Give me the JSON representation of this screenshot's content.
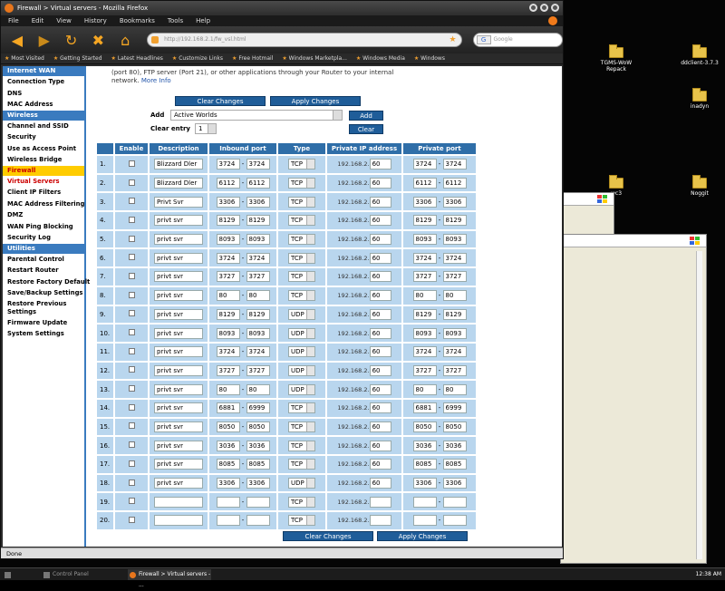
{
  "window": {
    "title": "Firewall > Virtual servers - Mozilla Firefox"
  },
  "menu": [
    "File",
    "Edit",
    "View",
    "History",
    "Bookmarks",
    "Tools",
    "Help"
  ],
  "url": "http://192.168.2.1/fw_vsl.html",
  "search_placeholder": "Google",
  "bookmarks": [
    "Most Visited",
    "Getting Started",
    "Latest Headlines",
    "Customize Links",
    "Free Hotmail",
    "Windows Marketpla...",
    "Windows Media",
    "Windows"
  ],
  "sidebar": [
    {
      "type": "head",
      "label": "Internet WAN"
    },
    {
      "type": "item",
      "label": "Connection Type"
    },
    {
      "type": "item",
      "label": "DNS"
    },
    {
      "type": "item",
      "label": "MAC Address"
    },
    {
      "type": "head",
      "label": "Wireless"
    },
    {
      "type": "item",
      "label": "Channel and SSID"
    },
    {
      "type": "item",
      "label": "Security"
    },
    {
      "type": "item",
      "label": "Use as Access Point"
    },
    {
      "type": "item",
      "label": "Wireless Bridge"
    },
    {
      "type": "head",
      "label": "Firewall",
      "active": true
    },
    {
      "type": "item",
      "label": "Virtual Servers",
      "active": true
    },
    {
      "type": "item",
      "label": "Client IP Filters"
    },
    {
      "type": "item",
      "label": "MAC Address Filtering"
    },
    {
      "type": "item",
      "label": "DMZ"
    },
    {
      "type": "item",
      "label": "WAN Ping Blocking"
    },
    {
      "type": "item",
      "label": "Security Log"
    },
    {
      "type": "head",
      "label": "Utilities"
    },
    {
      "type": "item",
      "label": "Parental Control"
    },
    {
      "type": "item",
      "label": "Restart Router"
    },
    {
      "type": "item",
      "label": "Restore Factory Default"
    },
    {
      "type": "item",
      "label": "Save/Backup Settings"
    },
    {
      "type": "item",
      "label": "Restore Previous Settings",
      "two": true
    },
    {
      "type": "item",
      "label": "Firmware Update"
    },
    {
      "type": "item",
      "label": "System Settings"
    }
  ],
  "intro": {
    "line1": "(port 80), FTP server (Port 21), or other applications through your Router to your internal",
    "line2": "network.",
    "more_info": "More Info"
  },
  "buttons": {
    "clear_changes": "Clear Changes",
    "apply_changes": "Apply Changes",
    "add": "Add",
    "clear": "Clear"
  },
  "add_label": "Add",
  "add_preset": "Active Worlds",
  "clear_entry_label": "Clear entry",
  "clear_entry_value": "1",
  "table": {
    "headers": [
      "",
      "Enable",
      "Description",
      "Inbound port",
      "Type",
      "Private IP address",
      "Private port"
    ],
    "ip_prefix": "192.168.2.",
    "rows": [
      {
        "n": "1.",
        "desc": "Blizzard Dler",
        "in1": "3724",
        "in2": "3724",
        "type": "TCP",
        "ip": "60",
        "p1": "3724",
        "p2": "3724"
      },
      {
        "n": "2.",
        "desc": "Blizzard Dler",
        "in1": "6112",
        "in2": "6112",
        "type": "TCP",
        "ip": "60",
        "p1": "6112",
        "p2": "6112"
      },
      {
        "n": "3.",
        "desc": "Privt Svr",
        "in1": "3306",
        "in2": "3306",
        "type": "TCP",
        "ip": "60",
        "p1": "3306",
        "p2": "3306"
      },
      {
        "n": "4.",
        "desc": "privt svr",
        "in1": "8129",
        "in2": "8129",
        "type": "TCP",
        "ip": "60",
        "p1": "8129",
        "p2": "8129"
      },
      {
        "n": "5.",
        "desc": "privt svr",
        "in1": "8093",
        "in2": "8093",
        "type": "TCP",
        "ip": "60",
        "p1": "8093",
        "p2": "8093"
      },
      {
        "n": "6.",
        "desc": "privt svr",
        "in1": "3724",
        "in2": "3724",
        "type": "TCP",
        "ip": "60",
        "p1": "3724",
        "p2": "3724"
      },
      {
        "n": "7.",
        "desc": "privt svr",
        "in1": "3727",
        "in2": "3727",
        "type": "TCP",
        "ip": "60",
        "p1": "3727",
        "p2": "3727"
      },
      {
        "n": "8.",
        "desc": "privt svr",
        "in1": "80",
        "in2": "80",
        "type": "TCP",
        "ip": "60",
        "p1": "80",
        "p2": "80"
      },
      {
        "n": "9.",
        "desc": "privt svr",
        "in1": "8129",
        "in2": "8129",
        "type": "UDP",
        "ip": "60",
        "p1": "8129",
        "p2": "8129"
      },
      {
        "n": "10.",
        "desc": "privt svr",
        "in1": "8093",
        "in2": "8093",
        "type": "UDP",
        "ip": "60",
        "p1": "8093",
        "p2": "8093"
      },
      {
        "n": "11.",
        "desc": "privt svr",
        "in1": "3724",
        "in2": "3724",
        "type": "UDP",
        "ip": "60",
        "p1": "3724",
        "p2": "3724"
      },
      {
        "n": "12.",
        "desc": "privt svr",
        "in1": "3727",
        "in2": "3727",
        "type": "UDP",
        "ip": "60",
        "p1": "3727",
        "p2": "3727"
      },
      {
        "n": "13.",
        "desc": "privt svr",
        "in1": "80",
        "in2": "80",
        "type": "UDP",
        "ip": "60",
        "p1": "80",
        "p2": "80"
      },
      {
        "n": "14.",
        "desc": "privt svr",
        "in1": "6881",
        "in2": "6999",
        "type": "TCP",
        "ip": "60",
        "p1": "6881",
        "p2": "6999"
      },
      {
        "n": "15.",
        "desc": "privt svr",
        "in1": "8050",
        "in2": "8050",
        "type": "TCP",
        "ip": "60",
        "p1": "8050",
        "p2": "8050"
      },
      {
        "n": "16.",
        "desc": "privt svr",
        "in1": "3036",
        "in2": "3036",
        "type": "TCP",
        "ip": "60",
        "p1": "3036",
        "p2": "3036"
      },
      {
        "n": "17.",
        "desc": "privt svr",
        "in1": "8085",
        "in2": "8085",
        "type": "TCP",
        "ip": "60",
        "p1": "8085",
        "p2": "8085"
      },
      {
        "n": "18.",
        "desc": "privt svr",
        "in1": "3306",
        "in2": "3306",
        "type": "UDP",
        "ip": "60",
        "p1": "3306",
        "p2": "3306"
      },
      {
        "n": "19.",
        "desc": "",
        "in1": "",
        "in2": "",
        "type": "TCP",
        "ip": "",
        "p1": "",
        "p2": ""
      },
      {
        "n": "20.",
        "desc": "",
        "in1": "",
        "in2": "",
        "type": "TCP",
        "ip": "",
        "p1": "",
        "p2": ""
      }
    ]
  },
  "status": "Done",
  "desktop_icons": [
    "TGMS-WoW Repack",
    "ddclient-3.7.3",
    "inadyn",
    "wc3",
    "Noggit"
  ],
  "taskbar": {
    "items": [
      "Control Panel",
      "Firewall > Virtual servers - ..."
    ],
    "clock": "12:38 AM"
  }
}
